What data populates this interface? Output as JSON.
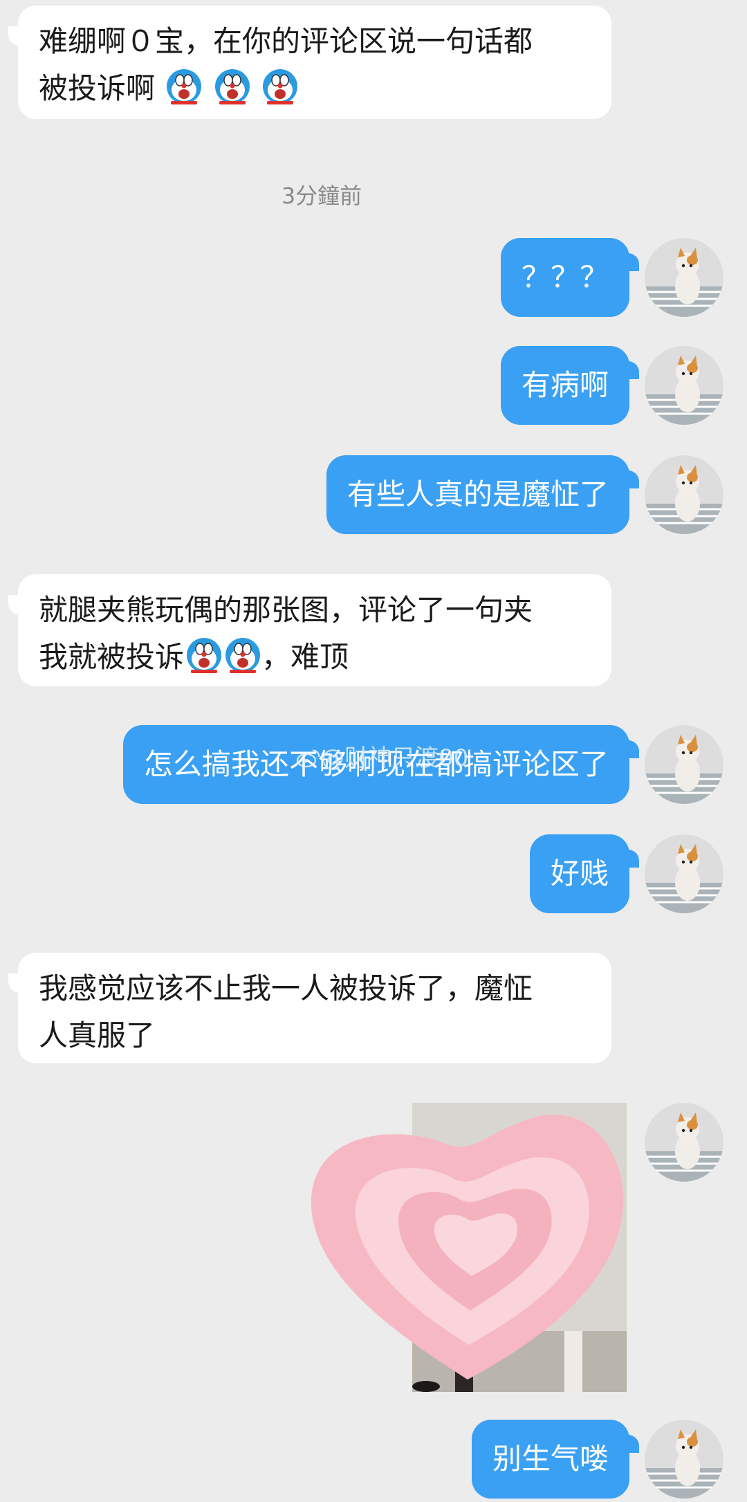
{
  "messages": [
    {
      "side": "left",
      "text_line1": "难绷啊０宝，在你的评论区说一句话都",
      "text_line2": "被投诉啊",
      "emoji_count": 3
    },
    {
      "side": "right",
      "text": "？？？"
    },
    {
      "side": "right",
      "text": "有病啊"
    },
    {
      "side": "right",
      "text": "有些人真的是魔怔了"
    },
    {
      "side": "left",
      "text_line1": "就腿夹熊玩偶的那张图，评论了一句夹",
      "text_line2a": "我就被投诉",
      "text_line2b": "，难顶",
      "emoji_count": 2
    },
    {
      "side": "right",
      "text": "怎么搞我还不够啊现在都搞评论区了"
    },
    {
      "side": "right",
      "text": "好贱"
    },
    {
      "side": "left",
      "text_line1": "我感觉应该不止我一人被投诉了，魔怔",
      "text_line2": "人真服了"
    },
    {
      "side": "right",
      "type": "image"
    },
    {
      "side": "right",
      "text": "别生气喽"
    }
  ],
  "timestamp": "3分鐘前",
  "watermark": "@财神只渡00",
  "colors": {
    "background": "#ececec",
    "bubble_right": "#3aa0f3",
    "bubble_left": "#ffffff",
    "heart": "#f6b9c4"
  },
  "icons": {
    "emoji": "doraemon-face-icon",
    "avatar": "cat-avatar"
  }
}
